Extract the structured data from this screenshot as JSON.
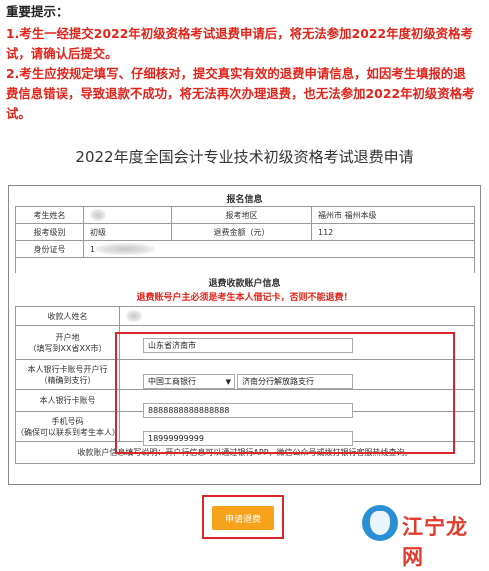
{
  "notice": {
    "title": "重要提示：",
    "lines": [
      "1.考生一经提交2022年初级资格考试退费申请后，将无法参加2022年度初级资格考",
      "试，请确认后提交。",
      "2.考生应按规定填写、仔细核对，提交真实有效的退费申请信息，如因考生填报的退",
      "费信息错误，导致退款不成功，将无法再次办理退费，也无法参加2022年初级资格考",
      "试。"
    ]
  },
  "page_title": "2022年度全国会计专业技术初级资格考试退费申请",
  "signup": {
    "header": "报名信息",
    "name_label": "考生姓名",
    "area_label": "报考地区",
    "area_value": "福州市 福州本级",
    "level_label": "报考级别",
    "level_value": "初级",
    "fee_label": "退费金额（元）",
    "fee_value": "112",
    "id_label": "身份证号",
    "id_value": "1"
  },
  "refund": {
    "header": "退费收款账户信息",
    "warning": "退费账号户主必须是考生本人借记卡，否则不能退费！",
    "holder_label": "收款人姓名",
    "origin_label_1": "开户地",
    "origin_label_2": "（填写到XX省XX市）",
    "origin_value": "山东省济南市",
    "bank_label_1": "本人银行卡账号开户行",
    "bank_label_2": "（精确到支行）",
    "bank_select": "中国工商银行",
    "branch_value": "济南分行解放路支行",
    "account_label": "本人银行卡账号",
    "account_value": "8888888888888888",
    "phone_label_1": "手机号码",
    "phone_label_2": "（确保可以联系到考生本人）",
    "phone_value": "18999999999",
    "note": "收款账户信息填写说明：开户行信息可以通过银行APP，微信公众号或拨打银行客服热线查询。"
  },
  "submit_label": "申请退费",
  "watermark": "江宁龙网",
  "colors": {
    "warning_red": "#e2231a",
    "submit_orange": "#f7a21b",
    "highlight_red": "#d9262a"
  }
}
